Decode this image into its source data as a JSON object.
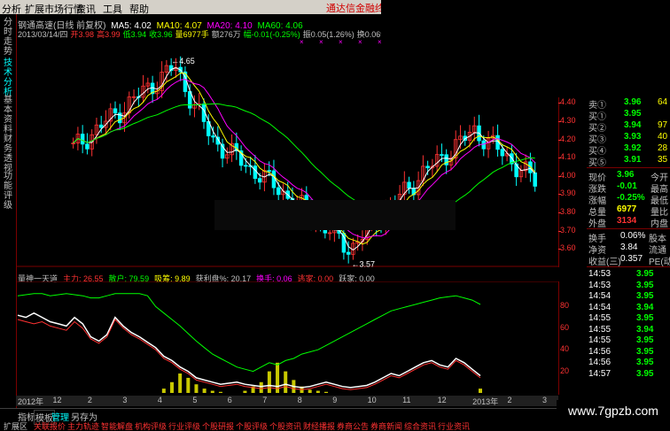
{
  "menu": {
    "items": [
      "分析",
      "扩展市场行情",
      "资讯",
      "工具",
      "帮助"
    ],
    "brand": "通达信金融终"
  },
  "sidebar": {
    "tabs": [
      "分时走势",
      "技术分析",
      "基本资料",
      "财务透视",
      "功能评级"
    ]
  },
  "header": {
    "title": "钢通高速(日线 前复权)",
    "ma": [
      {
        "label": "MA5: 4.02",
        "color": "#ffffff"
      },
      {
        "label": "MA10: 4.07",
        "color": "#ffff00"
      },
      {
        "label": "MA20: 4.10",
        "color": "#ff00ff"
      },
      {
        "label": "MA60: 4.06",
        "color": "#00ff00"
      }
    ],
    "ohlc": [
      {
        "label": "2013/03/14/四",
        "color": "#c0c0c0"
      },
      {
        "label": "开3.98",
        "color": "#ff3232"
      },
      {
        "label": "高3.99",
        "color": "#ff3232"
      },
      {
        "label": "低3.94",
        "color": "#00ff00"
      },
      {
        "label": "收3.96",
        "color": "#00ff00"
      },
      {
        "label": "量6977手",
        "color": "#ffff00"
      },
      {
        "label": "额276万",
        "color": "#c0c0c0"
      },
      {
        "label": "幅-0.01(-0.25%)",
        "color": "#00ff00"
      },
      {
        "label": "振0.05(1.26%)",
        "color": "#c0c0c0"
      },
      {
        "label": "换0.06%",
        "color": "#c0c0c0"
      },
      {
        "label": "流通11.7亿",
        "color": "#c0c0c0"
      }
    ]
  },
  "chart_data": [
    {
      "type": "candlestick",
      "title": "钢通高速(日线 前复权)",
      "annotations": [
        "4.65",
        "3.57"
      ],
      "y_ticks": [
        "4.40",
        "4.30",
        "4.20",
        "4.10",
        "4.00",
        "3.90",
        "3.80",
        "3.70",
        "3.60"
      ],
      "series": [
        {
          "name": "MA5",
          "color": "#ffffff"
        },
        {
          "name": "MA10",
          "color": "#ffff00"
        },
        {
          "name": "MA20",
          "color": "#ff00ff"
        },
        {
          "name": "MA60",
          "color": "#00ff00"
        }
      ]
    },
    {
      "type": "line",
      "title": "量神一天道",
      "labels": [
        {
          "label": "量神一天道",
          "color": "#c0c0c0"
        },
        {
          "label": "主力: 26.55",
          "color": "#ff3232"
        },
        {
          "label": "散户: 79.59",
          "color": "#00ff00"
        },
        {
          "label": "吸筹: 9.89",
          "color": "#ffff00"
        },
        {
          "label": "获利盘%: 20.17",
          "color": "#c0c0c0"
        },
        {
          "label": "换手: 0.06",
          "color": "#ff00ff"
        },
        {
          "label": "逃家: 0.00",
          "color": "#ff3232"
        },
        {
          "label": "跃家: 0.00",
          "color": "#c0c0c0"
        }
      ],
      "y_ticks": [
        "80",
        "60",
        "40",
        "20"
      ],
      "x_ticks": [
        "2012年",
        "12",
        "2",
        "3",
        "4",
        "5",
        "6",
        "7",
        "8",
        "9",
        "10",
        "11",
        "12",
        "2013年",
        "2",
        "3"
      ],
      "series": [
        {
          "name": "主力",
          "color": "#ff3232",
          "values": [
            68,
            66,
            64,
            66,
            62,
            60,
            58,
            66,
            60,
            50,
            46,
            52,
            68,
            60,
            54,
            50,
            45,
            40,
            32,
            28,
            22,
            18,
            12,
            10,
            8,
            6,
            7,
            8,
            6,
            5,
            4,
            5,
            4,
            6,
            4,
            3,
            4,
            6,
            8,
            6,
            4,
            3,
            4,
            5,
            8,
            12,
            16,
            14,
            18,
            22,
            26,
            28,
            24,
            22,
            30,
            26,
            20,
            14
          ]
        },
        {
          "name": "散户",
          "color": "#00ff00",
          "values": [
            90,
            91,
            92,
            92,
            90,
            91,
            92,
            91,
            90,
            88,
            88,
            90,
            92,
            92,
            92,
            92,
            90,
            80,
            74,
            68,
            62,
            55,
            48,
            42,
            36,
            32,
            28,
            24,
            22,
            20,
            24,
            28,
            26,
            30,
            32,
            36,
            38,
            40,
            44,
            48,
            52,
            56,
            60,
            64,
            68,
            72,
            76,
            78,
            80,
            82,
            84,
            86,
            88,
            89,
            90,
            88,
            86,
            82
          ]
        },
        {
          "name": "白线",
          "color": "#ffffff",
          "values": [
            72,
            70,
            74,
            70,
            66,
            64,
            62,
            70,
            64,
            52,
            48,
            54,
            70,
            62,
            56,
            52,
            47,
            42,
            34,
            30,
            24,
            20,
            14,
            12,
            10,
            8,
            9,
            10,
            8,
            7,
            6,
            7,
            6,
            8,
            6,
            5,
            6,
            8,
            10,
            8,
            6,
            5,
            6,
            7,
            10,
            14,
            18,
            16,
            20,
            24,
            28,
            30,
            26,
            24,
            32,
            28,
            22,
            16
          ]
        },
        {
          "name": "吸筹",
          "color": "#ffff00",
          "values": [
            0,
            0,
            0,
            0,
            0,
            0,
            0,
            0,
            0,
            0,
            0,
            0,
            0,
            0,
            0,
            0,
            0,
            0,
            4,
            10,
            18,
            14,
            8,
            4,
            2,
            1,
            0,
            0,
            2,
            6,
            10,
            20,
            28,
            20,
            12,
            6,
            3,
            2,
            1,
            0,
            0,
            0,
            0,
            0,
            0,
            0,
            0,
            0,
            0,
            0,
            0,
            0,
            0,
            0,
            0,
            0,
            0,
            4
          ]
        }
      ]
    }
  ],
  "panel": {
    "bids": [
      {
        "label": "卖①",
        "price": "3.96",
        "vol": "64"
      },
      {
        "label": "买①",
        "price": "3.95",
        "vol": ""
      },
      {
        "label": "买②",
        "price": "3.94",
        "vol": "97"
      },
      {
        "label": "买③",
        "price": "3.93",
        "vol": "40"
      },
      {
        "label": "买④",
        "price": "3.92",
        "vol": "28"
      },
      {
        "label": "买⑤",
        "price": "3.91",
        "vol": "35"
      }
    ],
    "quote": [
      {
        "label": "现价",
        "value": "3.96",
        "extra": "今开",
        "vcolor": "#00ff00"
      },
      {
        "label": "涨跌",
        "value": "-0.01",
        "extra": "最高",
        "vcolor": "#00ff00"
      },
      {
        "label": "涨幅",
        "value": "-0.25%",
        "extra": "最低",
        "vcolor": "#00ff00"
      },
      {
        "label": "总量",
        "value": "6977",
        "extra": "量比",
        "vcolor": "#ffff00"
      },
      {
        "label": "外盘",
        "value": "3134",
        "extra": "内盘",
        "vcolor": "#ff3232"
      }
    ],
    "stats": [
      {
        "label": "换手",
        "value": "0.06%",
        "extra": "股本"
      },
      {
        "label": "净资",
        "value": "3.84",
        "extra": "流通"
      },
      {
        "label": "收益(三)",
        "value": "0.357",
        "extra": "PE(动"
      }
    ],
    "ticks": [
      {
        "time": "14:53",
        "price": "3.95"
      },
      {
        "time": "14:53",
        "price": "3.95"
      },
      {
        "time": "14:54",
        "price": "3.95"
      },
      {
        "time": "14:54",
        "price": "3.94"
      },
      {
        "time": "14:55",
        "price": "3.95"
      },
      {
        "time": "14:55",
        "price": "3.94"
      },
      {
        "time": "14:55",
        "price": "3.95"
      },
      {
        "time": "14:56",
        "price": "3.95"
      },
      {
        "time": "14:56",
        "price": "3.95"
      },
      {
        "time": "14:57",
        "price": "3.95"
      }
    ]
  },
  "bottombar": {
    "row1": [
      {
        "label": "指标",
        "color": "#c0c0c0"
      },
      {
        "label": "模板",
        "color": "#c0c0c0"
      },
      {
        "label": "管理",
        "color": "#00ffff"
      },
      {
        "label": "另存为",
        "color": "#c0c0c0"
      }
    ],
    "row2": [
      "关联报价",
      "主力轨迹",
      "智能解盘",
      "机构评级",
      "行业评级",
      "个股研报",
      "个股评级",
      "个股资讯",
      "财经播报",
      "券商公告",
      "券商新闻",
      "综合资讯",
      "行业资讯"
    ],
    "first": "扩展区"
  },
  "watermark": "www.7gpzb.com"
}
